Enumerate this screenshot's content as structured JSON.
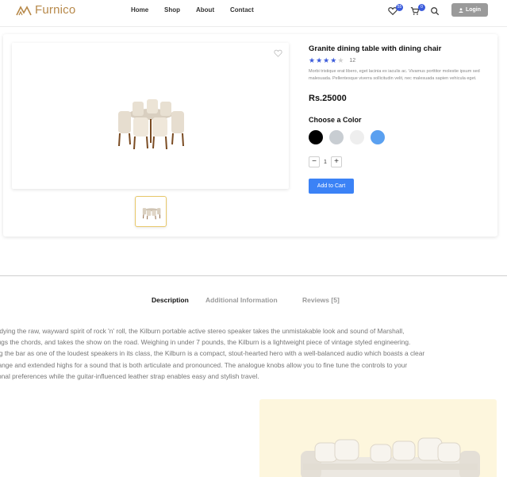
{
  "header": {
    "brand": "Furnico",
    "nav": [
      "Home",
      "Shop",
      "About",
      "Contact"
    ],
    "wishlist_count": "55",
    "cart_count": "0",
    "login_label": "Login"
  },
  "product": {
    "title": "Granite dining table with dining chair",
    "rating_stars": 4,
    "review_count": "12",
    "description": "Morbi tristique erat libero, eget lacinia ex iaculis ac. Vivamus porttitor molestie ipsum sed malesuada. Pellentesque viverra sollicitudin velit, nec malesuada sapien vehicula eget.",
    "price": "Rs.25000",
    "color_label": "Choose a Color",
    "colors": [
      "#000000",
      "#c8cdd2",
      "#eeeeee",
      "#5aa0f0"
    ],
    "quantity": "1",
    "qty_minus": "−",
    "qty_plus": "+",
    "add_to_cart": "Add to Cart"
  },
  "tabs": [
    "Description",
    "Additional Information",
    "Reviews [5]"
  ],
  "description_lines": [
    "bodying the raw, wayward spirit of rock 'n' roll, the Kilburn portable active stereo speaker takes the unmistakable look and sound of Marshall,",
    "plugs the chords, and takes the show on the road. Weighing in under 7 pounds, the Kilburn is a lightweight piece of vintage styled engineering.",
    "ting the bar as one of the loudest speakers in its class, the Kilburn is a compact, stout-hearted hero with a well-balanced audio which boasts a clear",
    "drange and extended highs for a sound that is both articulate and pronounced. The analogue knobs allow you to fine tune the controls to your",
    "rsonal preferences while the guitar-influenced leather strap enables easy and stylish travel."
  ]
}
